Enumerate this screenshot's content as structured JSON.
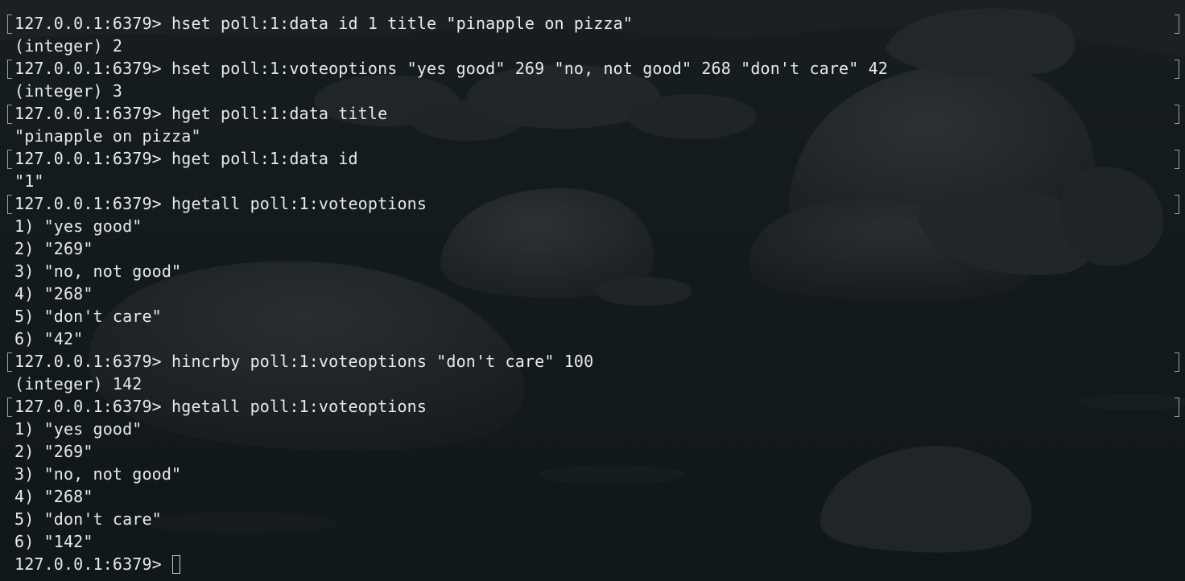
{
  "terminal": {
    "lines": [
      {
        "text": "127.0.0.1:6379> hset poll:1:data id 1 title \"pinapple on pizza\"",
        "kind": "command"
      },
      {
        "text": "(integer) 2",
        "kind": "output"
      },
      {
        "text": "127.0.0.1:6379> hset poll:1:voteoptions \"yes good\" 269 \"no, not good\" 268 \"don't care\" 42",
        "kind": "command"
      },
      {
        "text": "(integer) 3",
        "kind": "output"
      },
      {
        "text": "127.0.0.1:6379> hget poll:1:data title",
        "kind": "command"
      },
      {
        "text": "\"pinapple on pizza\"",
        "kind": "output"
      },
      {
        "text": "127.0.0.1:6379> hget poll:1:data id",
        "kind": "command"
      },
      {
        "text": "\"1\"",
        "kind": "output"
      },
      {
        "text": "127.0.0.1:6379> hgetall poll:1:voteoptions",
        "kind": "command"
      },
      {
        "text": "1) \"yes good\"",
        "kind": "output"
      },
      {
        "text": "2) \"269\"",
        "kind": "output"
      },
      {
        "text": "3) \"no, not good\"",
        "kind": "output"
      },
      {
        "text": "4) \"268\"",
        "kind": "output"
      },
      {
        "text": "5) \"don't care\"",
        "kind": "output"
      },
      {
        "text": "6) \"42\"",
        "kind": "output"
      },
      {
        "text": "127.0.0.1:6379> hincrby poll:1:voteoptions \"don't care\" 100",
        "kind": "command"
      },
      {
        "text": "(integer) 142",
        "kind": "output"
      },
      {
        "text": "127.0.0.1:6379> hgetall poll:1:voteoptions",
        "kind": "command"
      },
      {
        "text": "1) \"yes good\"",
        "kind": "output"
      },
      {
        "text": "2) \"269\"",
        "kind": "output"
      },
      {
        "text": "3) \"no, not good\"",
        "kind": "output"
      },
      {
        "text": "4) \"268\"",
        "kind": "output"
      },
      {
        "text": "5) \"don't care\"",
        "kind": "output"
      },
      {
        "text": "6) \"142\"",
        "kind": "output"
      }
    ],
    "prompt": "127.0.0.1:6379> ",
    "input_value": ""
  },
  "colors": {
    "text": "#e9e9e9",
    "background": "#1b2226"
  }
}
